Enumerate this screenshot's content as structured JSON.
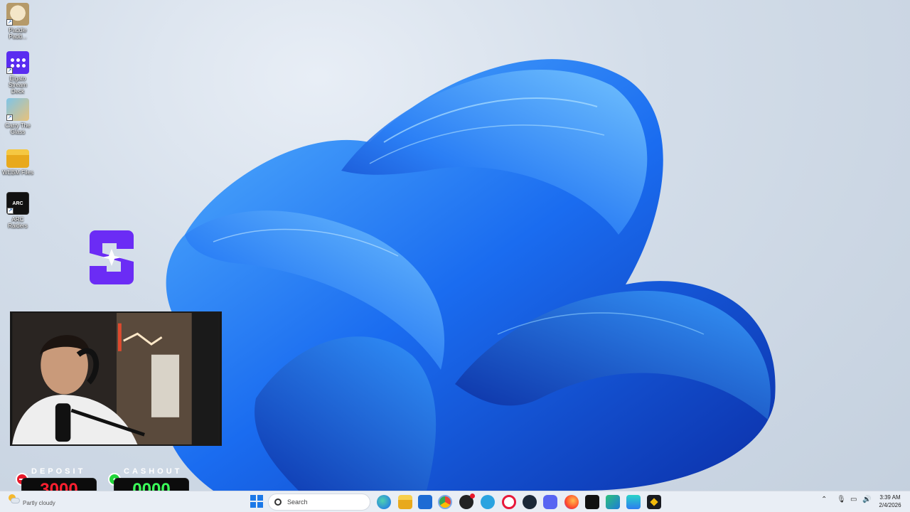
{
  "desktop": {
    "icons": [
      {
        "label": "Paddle Padd...",
        "icon": "paddle-face-icon"
      },
      {
        "label": "Elgato Stream Deck",
        "icon": "stream-deck-icon"
      },
      {
        "label": "Carry The Glass",
        "icon": "carry-the-glass-icon"
      },
      {
        "label": "WEBM Files",
        "icon": "folder-icon"
      },
      {
        "label": "ARC Raiders",
        "icon": "arc-raiders-icon"
      }
    ]
  },
  "overlay": {
    "deposit": {
      "caption": "DEPOSIT",
      "value": "3000",
      "color": "#e8182a"
    },
    "cashout": {
      "caption": "CASHOUT",
      "value": "0000",
      "color": "#22d63b"
    },
    "logo": "stake-logo-icon"
  },
  "taskbar": {
    "weather_text": "Partly cloudy",
    "search_placeholder": "Search",
    "apps": [
      "start-icon",
      "search-icon",
      "edge-icon",
      "file-explorer-icon",
      "store-icon",
      "chrome-icon",
      "discord-alt-icon",
      "telegram-icon",
      "opera-icon",
      "steam-icon",
      "discord-icon",
      "firefox-icon",
      "epic-icon",
      "app-icon",
      "vpn-icon",
      "binance-icon"
    ],
    "time": "3:39 AM",
    "date": "2/4/2026"
  },
  "colors": {
    "accent": "#1a6cf0",
    "taskbar": "#e9eef5",
    "logo": "#6b2cf5"
  }
}
